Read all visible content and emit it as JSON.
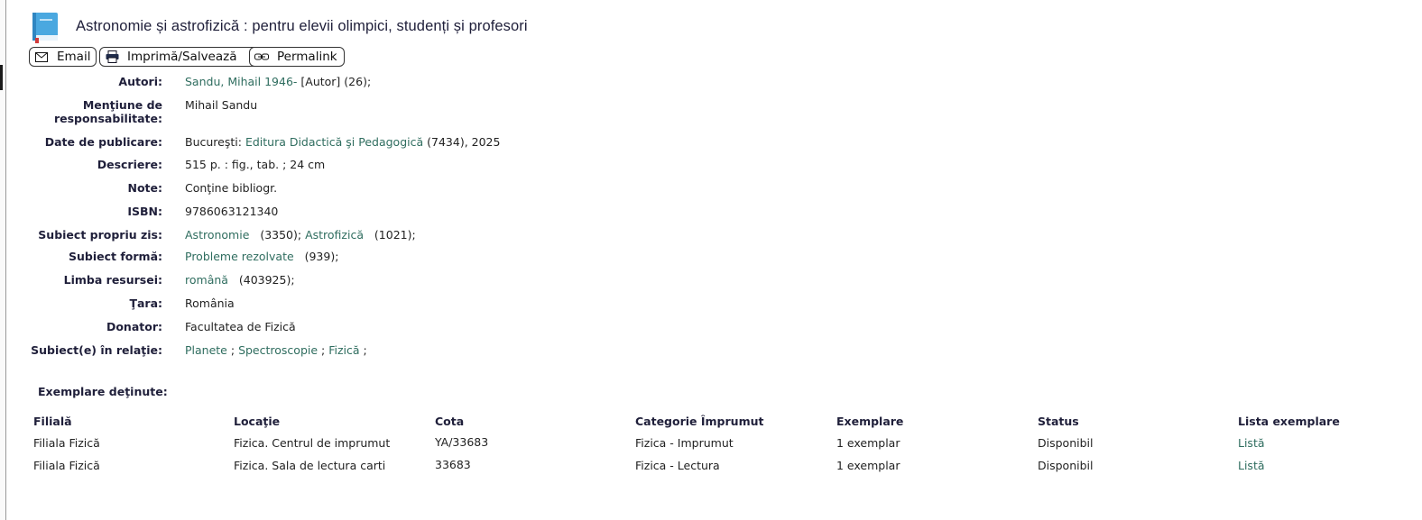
{
  "record": {
    "title": "Astronomie și astrofizică : pentru elevii olimpici, studenți și profesori"
  },
  "toolbar": {
    "email_label": "Email",
    "print_label": "Imprimă/Salvează",
    "permalink_label": "Permalink"
  },
  "fields": {
    "authors": {
      "label": "Autori:",
      "name": "Sandu, Mihail 1946-",
      "role": "[Autor]",
      "count": "(26);"
    },
    "responsibility": {
      "label_line1": "Menţiune de",
      "label_line2": "responsabilitate:",
      "value": "Mihail Sandu"
    },
    "publication": {
      "label": "Date de publicare:",
      "place": "Bucureşti:",
      "publisher": "Editura Didactică şi Pedagogică",
      "rest": "(7434), 2025"
    },
    "description": {
      "label": "Descriere:",
      "value": "515 p. : fig., tab. ; 24 cm"
    },
    "notes": {
      "label": "Note:",
      "value": "Conţine bibliogr."
    },
    "isbn": {
      "label": "ISBN:",
      "value": "9786063121340"
    },
    "subject": {
      "label": "Subiect propriu zis:",
      "items": [
        {
          "name": "Astronomie",
          "count": "(3350);"
        },
        {
          "name": "Astrofizică",
          "count": "(1021);"
        }
      ]
    },
    "subject_form": {
      "label": "Subiect formă:",
      "name": "Probleme rezolvate",
      "count": "(939);"
    },
    "language": {
      "label": "Limba resursei:",
      "name": "română",
      "count": "(403925);"
    },
    "country": {
      "label": "Ţara:",
      "value": "România"
    },
    "donor": {
      "label": "Donator:",
      "value": "Facultatea de Fizică"
    },
    "related": {
      "label": "Subiect(e) în relaţie:",
      "items": [
        "Planete",
        "Spectroscopie",
        "Fizică"
      ],
      "sep": ";"
    }
  },
  "holdings": {
    "title": "Exemplare deţinute:",
    "columns": [
      "Filială",
      "Locaţie",
      "Cota",
      "Categorie Împrumut",
      "Exemplare",
      "Status",
      "Lista exemplare"
    ],
    "rows": [
      [
        "Filiala Fizică",
        "Fizica. Centrul de imprumut",
        "YA/33683",
        "Fizica - Imprumut",
        "1 exemplar",
        "Disponibil",
        "Listă"
      ],
      [
        "Filiala Fizică",
        "Fizica. Sala de lectura carti",
        "33683",
        "Fizica - Lectura",
        "1 exemplar",
        "Disponibil",
        "Listă"
      ]
    ]
  },
  "colors": {
    "link": "#2f6d5f",
    "label": "#1f1f3a",
    "icon_blue": "#4aa8e0"
  },
  "icons": [
    "book-icon",
    "envelope-icon",
    "printer-icon",
    "link-icon"
  ]
}
